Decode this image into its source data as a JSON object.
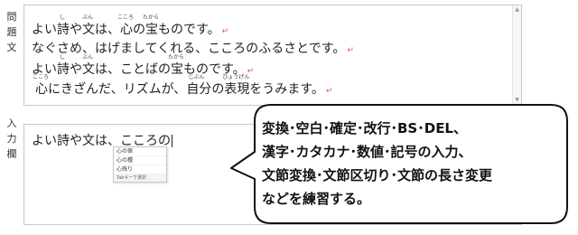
{
  "labels": {
    "question": [
      "問",
      "題",
      "文"
    ],
    "input": [
      "入",
      "力",
      "欄"
    ]
  },
  "question_lines": [
    {
      "before": "よい",
      "r1_base": "詩",
      "r1": "し",
      "mid": "や",
      "r2_base": "文",
      "r2": "ぶん",
      "mid2": "は、",
      "r3_base": "心",
      "r3": "こころ",
      "mid3": "の",
      "r4_base": "宝",
      "r4": "たから",
      "after": "ものです。",
      "ret": "↵"
    },
    {
      "text": "なぐさめ、はげましてくれる、こころのふるさとです。",
      "ret": "↵"
    },
    {
      "before": "よい",
      "r1_base": "詩",
      "r1": "し",
      "mid": "や",
      "r2_base": "文",
      "r2": "ぶん",
      "mid2": "は、ことばの",
      "r3_base": "宝",
      "r3": "たから",
      "after": "ものです。",
      "ret": "↵"
    },
    {
      "r1_base": "心",
      "r1": "こころ",
      "mid": "にきざんだ、リズムが、",
      "r2_base": "自分",
      "r2": "じぶん",
      "mid2": "の",
      "r3_base": "表",
      "r3": "ひょうげん",
      "after": "現をうみます。",
      "ret": "↵"
    }
  ],
  "input": {
    "text": "よい詩や文は、こころの"
  },
  "ime": {
    "candidates": [
      "心の宿",
      "心の種",
      "心残り"
    ],
    "footer": "Tabキーで選択"
  },
  "bubble": {
    "lines": [
      "変換･空白･確定･改行･BS･DEL、",
      "漢字･カタカナ･数値･記号の入力、",
      "文節変換･文節区切り･文節の長さ変更",
      "などを練習する。"
    ]
  },
  "scroll": {
    "up": "▲",
    "down": "▼"
  }
}
